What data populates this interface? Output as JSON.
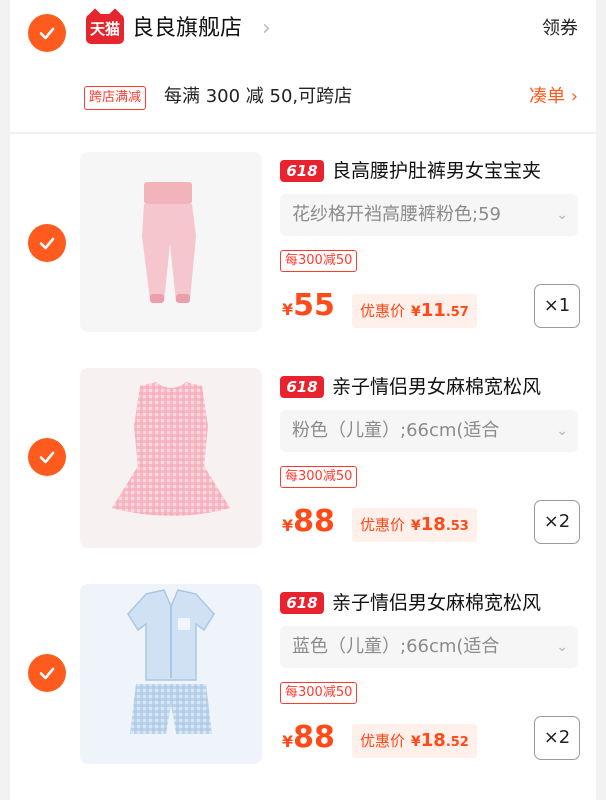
{
  "shop": {
    "badge": "天猫",
    "name": "良良旗舰店",
    "chevron": "›",
    "coupon": "领券"
  },
  "promo": {
    "tag": "跨店满减",
    "text": "每满 300 减 50,可跨店",
    "action": "凑单 ›"
  },
  "colors": {
    "accent": "#ff5b1f",
    "price": "#ff4a1a",
    "tag618": "#e8232d"
  },
  "items": [
    {
      "tag": "618",
      "title": "良高腰护肚裤男女宝宝夹",
      "sku": "花纱格开裆高腰裤粉色;59",
      "sku_arrow": "⌄",
      "discount": "每300减50",
      "currency": "¥",
      "price": "55",
      "deal_label": "优惠价",
      "deal_currency": "¥",
      "deal_int": "11",
      "deal_dec": ".57",
      "qty": "×1",
      "image": "pink-pants-image"
    },
    {
      "tag": "618",
      "title": "亲子情侣男女麻棉宽松风",
      "sku": "粉色（儿童）;66cm(适合",
      "sku_arrow": "⌄",
      "discount": "每300减50",
      "currency": "¥",
      "price": "88",
      "deal_label": "优惠价",
      "deal_currency": "¥",
      "deal_int": "18",
      "deal_dec": ".53",
      "qty": "×2",
      "image": "pink-dress-image"
    },
    {
      "tag": "618",
      "title": "亲子情侣男女麻棉宽松风",
      "sku": "蓝色（儿童）;66cm(适合",
      "sku_arrow": "⌄",
      "discount": "每300减50",
      "currency": "¥",
      "price": "88",
      "deal_label": "优惠价",
      "deal_currency": "¥",
      "deal_int": "18",
      "deal_dec": ".52",
      "qty": "×2",
      "image": "blue-pajama-set-image"
    }
  ]
}
